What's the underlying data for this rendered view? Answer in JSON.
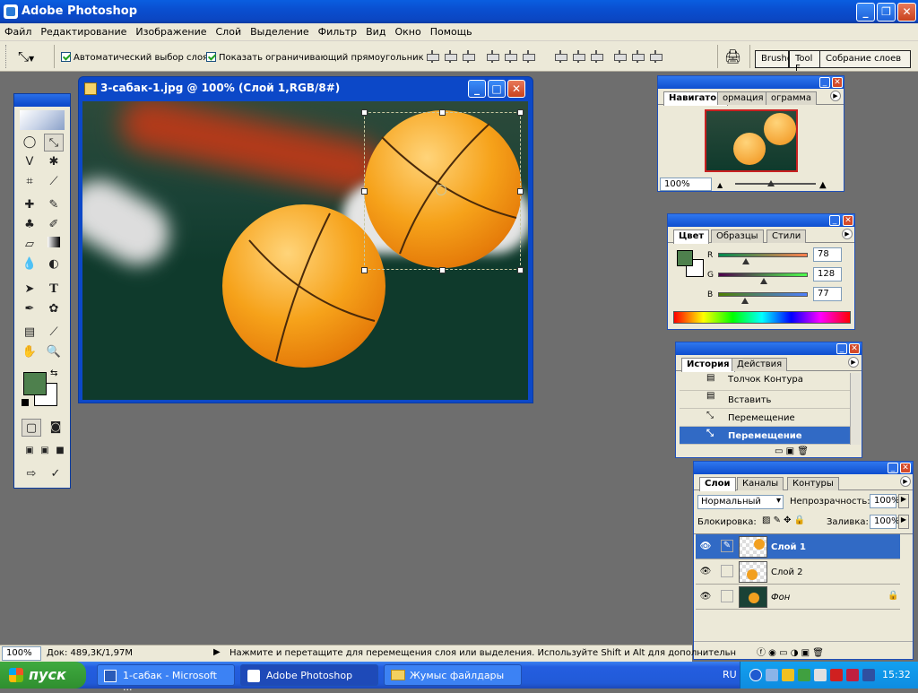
{
  "app": {
    "title": "Adobe Photoshop"
  },
  "menu": [
    "Файл",
    "Редактирование",
    "Изображение",
    "Слой",
    "Выделение",
    "Фильтр",
    "Вид",
    "Окно",
    "Помощь"
  ],
  "options": {
    "auto_select": "Автоматический выбор слоя",
    "show_bounds": "Показать ограничивающий прямоугольник",
    "well_tabs": [
      "Brushe",
      "Tool F",
      "Собрание слоев"
    ]
  },
  "document": {
    "title": "3-сабак-1.jpg @ 100% (Слой 1,RGB/8#)"
  },
  "navigator": {
    "tabs": [
      "Навигатор",
      "ормация",
      "ограмма"
    ],
    "zoom": "100%"
  },
  "color": {
    "tabs": [
      "Цвет",
      "Образцы",
      "Стили"
    ],
    "r_label": "R",
    "g_label": "G",
    "b_label": "B",
    "r": "78",
    "g": "128",
    "b": "77",
    "foreground": "#4e804d"
  },
  "history": {
    "tabs": [
      "История",
      "Действия"
    ],
    "items": [
      "Толчок Контура",
      "Вставить",
      "Перемещение",
      "Перемещение"
    ]
  },
  "layers": {
    "tabs": [
      "Слои",
      "Каналы",
      "Контуры"
    ],
    "blend_mode": "Нормальный",
    "opacity_label": "Непрозрачность:",
    "opacity": "100%",
    "lock_label": "Блокировка:",
    "fill_label": "Заливка:",
    "fill": "100%",
    "items": [
      "Слой 1",
      "Слой 2",
      "Фон"
    ]
  },
  "status": {
    "zoom": "100%",
    "doc": "Док: 489,3K/1,97M",
    "hint": "Нажмите и перетащите для перемещения слоя или выделения. Используйте Shift и Alt для дополнительн"
  },
  "taskbar": {
    "start": "пуск",
    "tasks": [
      "1-сабак - Microsoft ...",
      "Adobe Photoshop",
      "Жумыс файлдары"
    ],
    "lang": "RU",
    "clock": "15:32"
  }
}
